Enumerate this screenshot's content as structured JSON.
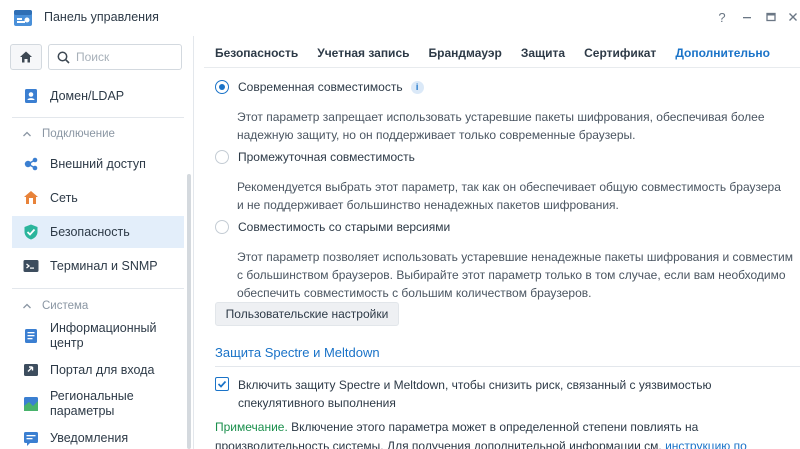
{
  "window": {
    "title": "Панель управления",
    "help_label": "?"
  },
  "sidebar": {
    "search_placeholder": "Поиск",
    "items": {
      "domain": "Домен/LDAP",
      "section_connection": "Подключение",
      "external_access": "Внешний доступ",
      "network": "Сеть",
      "security": "Безопасность",
      "terminal": "Терминал и SNMP",
      "section_system": "Система",
      "info_center_1": "Информационный",
      "info_center_2": "центр",
      "login_portal": "Портал для входа",
      "regional_1": "Региональные",
      "regional_2": "параметры",
      "notifications": "Уведомления"
    }
  },
  "tabs": [
    {
      "label": "Безопасность"
    },
    {
      "label": "Учетная запись"
    },
    {
      "label": "Брандмауэр"
    },
    {
      "label": "Защита"
    },
    {
      "label": "Сертификат"
    },
    {
      "label": "Дополнительно"
    }
  ],
  "compat": {
    "modern": {
      "label": "Современная совместимость",
      "desc_1": "Этот параметр запрещает использовать устаревшие пакеты шифрования, обеспечивая более",
      "desc_2": "надежную защиту, но он поддерживает только современные браузеры."
    },
    "intermediate": {
      "label": "Промежуточная совместимость",
      "desc_1": "Рекомендуется выбрать этот параметр, так как он обеспечивает общую совместимость браузера",
      "desc_2": "и не поддерживает большинство ненадежных пакетов шифрования."
    },
    "legacy": {
      "label": "Совместимость со старыми версиями",
      "desc_1": "Этот параметр позволяет использовать устаревшие ненадежные пакеты шифрования и совместим",
      "desc_2": "с большинством браузеров. Выбирайте этот параметр только в том случае, если вам необходимо",
      "desc_3": "обеспечить совместимость с большим количеством браузеров."
    },
    "selected": "modern",
    "custom_button": "Пользовательские настройки"
  },
  "spectre": {
    "title": "Защита Spectre и Meltdown",
    "checkbox_line_1": "Включить защиту Spectre и Meltdown, чтобы снизить риск, связанный с уязвимостью",
    "checkbox_line_2": "спекулятивного выполнения",
    "checked": true
  },
  "note": {
    "label": "Примечание.",
    "line_1": " Включение этого параметра может в определенной степени повлиять на",
    "line_2": "производительность системы. Для получения дополнительной информации см. ",
    "link": "инструкцию по"
  },
  "colors": {
    "accent": "#1a73c8",
    "note_green": "#1a8f4c",
    "active_nav_bg": "#e3eefa"
  }
}
